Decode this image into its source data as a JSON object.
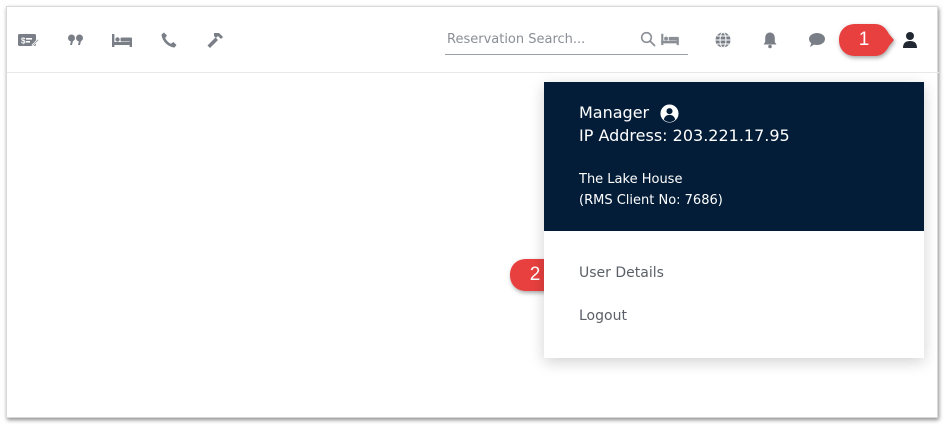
{
  "toolbar": {
    "icons": [
      "money-card-icon",
      "quote-icon",
      "bed-icon",
      "phone-icon",
      "hammer-icon"
    ],
    "right_icons": [
      "globe-icon",
      "bell-icon",
      "chat-icon",
      "user-icon"
    ]
  },
  "search": {
    "placeholder": "Reservation Search...",
    "value": ""
  },
  "user_menu": {
    "role": "Manager",
    "ip_address": "IP Address: 203.221.17.95",
    "property": "The Lake House",
    "client": "(RMS Client No: 7686)",
    "items": [
      "User Details",
      "Logout"
    ]
  },
  "callouts": [
    "1",
    "2"
  ],
  "colors": {
    "header_bg": "#031d38",
    "callout": "#e8403f",
    "icon": "#7a7f87"
  }
}
